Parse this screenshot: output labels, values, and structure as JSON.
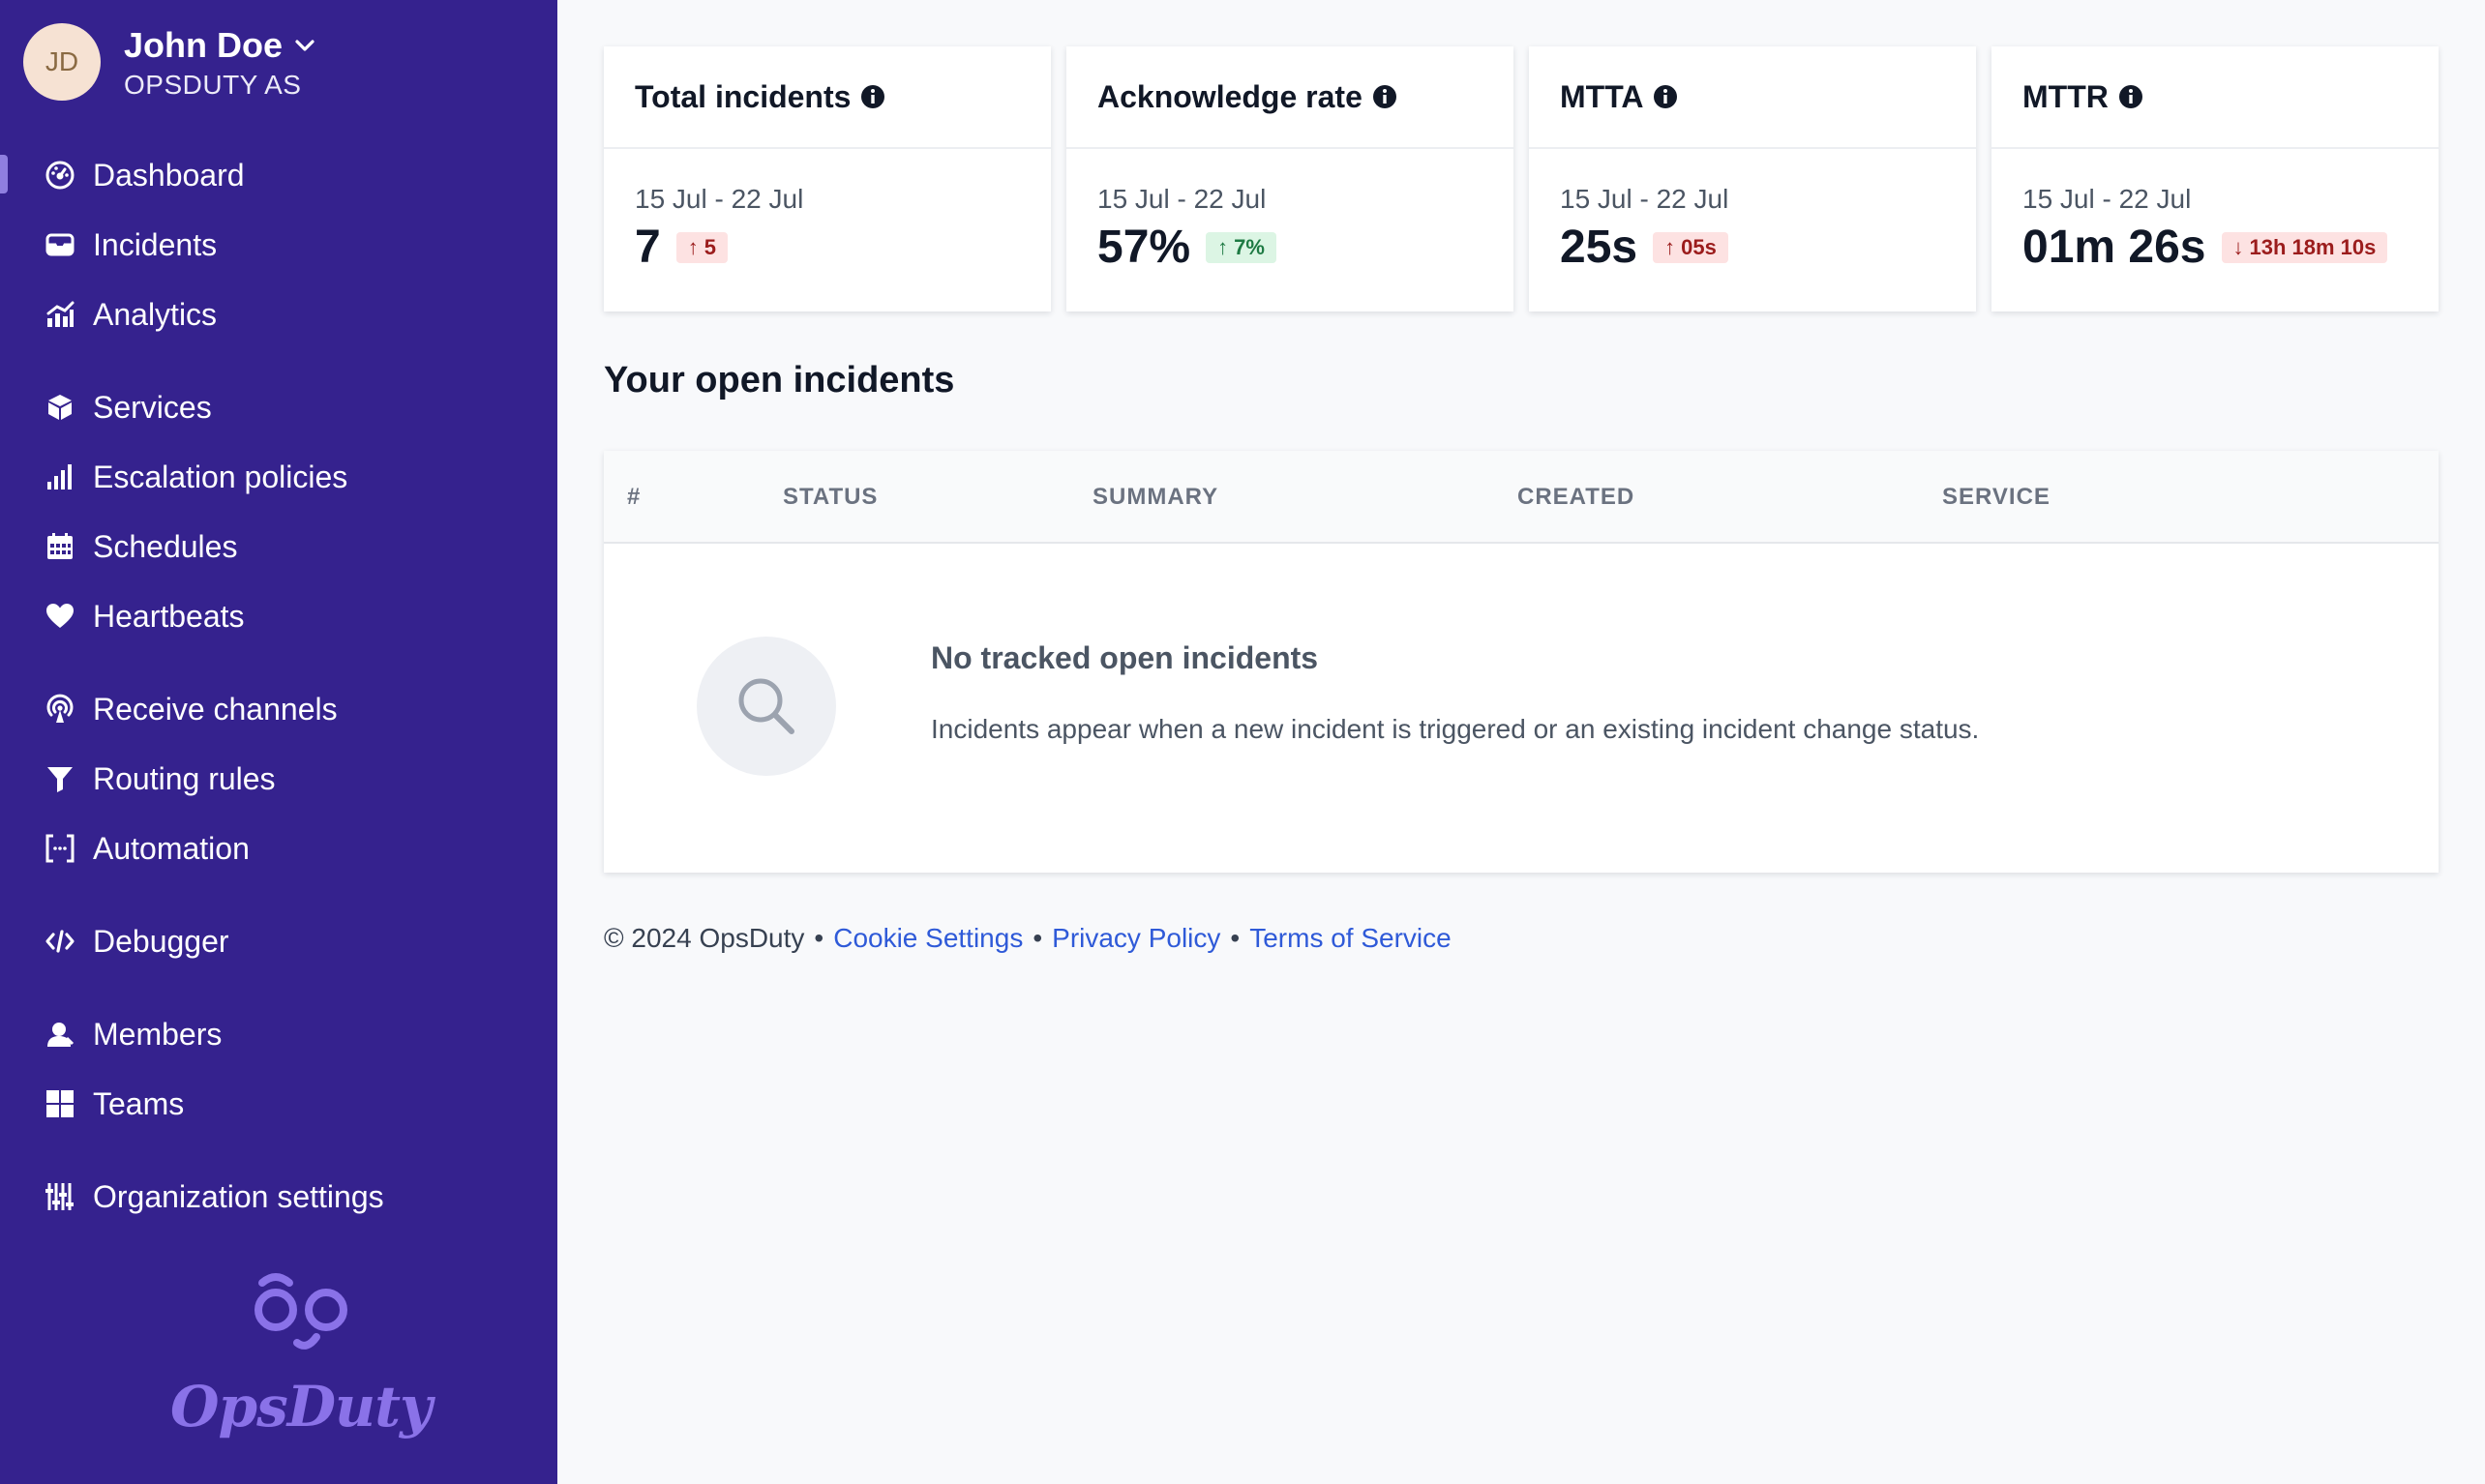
{
  "user": {
    "initials": "JD",
    "name": "John Doe",
    "org": "OPSDUTY AS"
  },
  "nav": {
    "items": [
      {
        "label": "Dashboard",
        "icon": "dashboard-gauge-icon",
        "active": true
      },
      {
        "label": "Incidents",
        "icon": "inbox-icon"
      },
      {
        "label": "Analytics",
        "icon": "analytics-chart-icon"
      },
      {
        "label": "Services",
        "icon": "cube-icon"
      },
      {
        "label": "Escalation policies",
        "icon": "bar-levels-icon"
      },
      {
        "label": "Schedules",
        "icon": "calendar-icon"
      },
      {
        "label": "Heartbeats",
        "icon": "heart-icon"
      },
      {
        "label": "Receive channels",
        "icon": "broadcast-icon"
      },
      {
        "label": "Routing rules",
        "icon": "filter-funnel-icon"
      },
      {
        "label": "Automation",
        "icon": "brackets-icon"
      },
      {
        "label": "Debugger",
        "icon": "code-icon"
      },
      {
        "label": "Members",
        "icon": "user-icon"
      },
      {
        "label": "Teams",
        "icon": "grid-icon"
      },
      {
        "label": "Organization settings",
        "icon": "sliders-icon"
      }
    ]
  },
  "logo": {
    "text": "OpsDuty"
  },
  "metrics": [
    {
      "title": "Total incidents",
      "range": "15 Jul - 22 Jul",
      "value": "7",
      "delta": "5",
      "direction": "up",
      "tone": "red"
    },
    {
      "title": "Acknowledge rate",
      "range": "15 Jul - 22 Jul",
      "value": "57%",
      "delta": "7%",
      "direction": "up",
      "tone": "green"
    },
    {
      "title": "MTTA",
      "range": "15 Jul - 22 Jul",
      "value": "25s",
      "delta": "05s",
      "direction": "up",
      "tone": "red"
    },
    {
      "title": "MTTR",
      "range": "15 Jul - 22 Jul",
      "value": "01m 26s",
      "delta": "13h 18m 10s",
      "direction": "down",
      "tone": "red"
    }
  ],
  "open_incidents": {
    "title": "Your open incidents",
    "columns": [
      "#",
      "STATUS",
      "SUMMARY",
      "CREATED",
      "SERVICE"
    ],
    "empty_title": "No tracked open incidents",
    "empty_description": "Incidents appear when a new incident is triggered or an existing incident change status."
  },
  "footer": {
    "copyright": "© 2024 OpsDuty",
    "links": [
      "Cookie Settings",
      "Privacy Policy",
      "Terms of Service"
    ],
    "separator": "•"
  },
  "colors": {
    "sidebar_bg": "#35228e",
    "link": "#2f5ad8",
    "badge_red_bg": "#fde2e2",
    "badge_green_bg": "#dcf5e4"
  }
}
